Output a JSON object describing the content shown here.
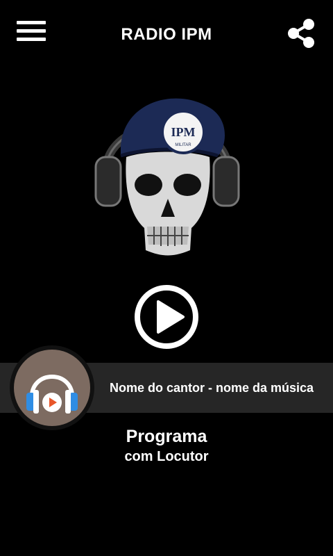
{
  "header": {
    "title": "RADIO IPM",
    "menu_icon": "hamburger-menu-icon",
    "share_icon": "share-icon"
  },
  "logo": {
    "badge_text": "IPM",
    "badge_subtext": "MILITAR"
  },
  "player": {
    "play_icon": "play-icon",
    "now_playing": "Nome do cantor - nome da música",
    "cover_icon": "headphones-play-icon"
  },
  "program": {
    "name": "Programa",
    "announcer": "com Locutor"
  },
  "colors": {
    "background": "#000000",
    "bar": "#262626",
    "cover": "#7d6b61",
    "beret": "#1c2a55"
  }
}
